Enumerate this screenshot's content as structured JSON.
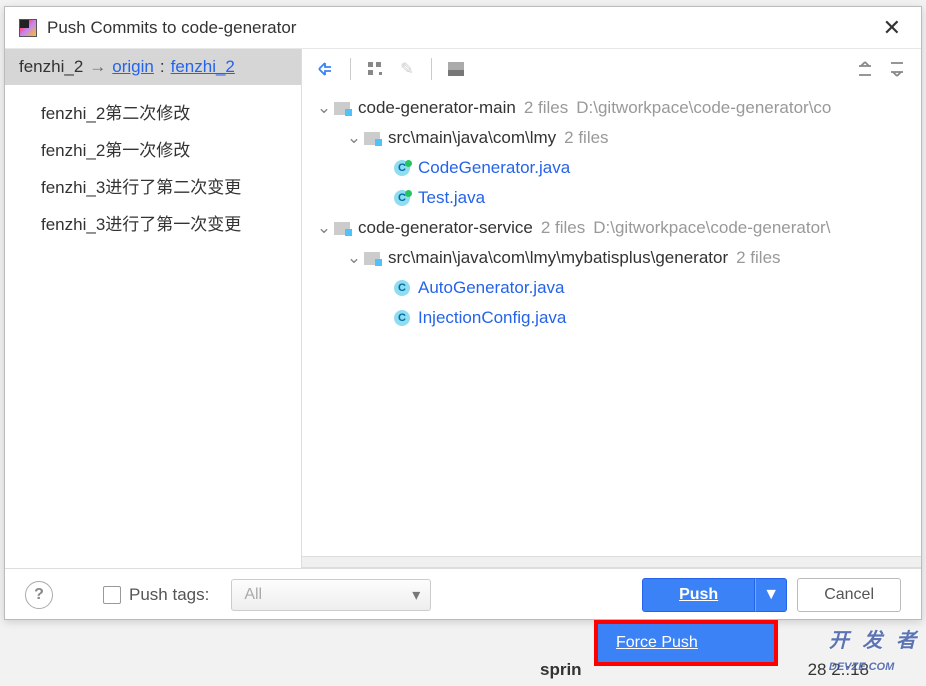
{
  "dialog": {
    "title": "Push Commits to code-generator"
  },
  "branch": {
    "local": "fenzhi_2",
    "remote": "origin",
    "remoteBranch": "fenzhi_2"
  },
  "commits": [
    "fenzhi_2第二次修改",
    "fenzhi_2第一次修改",
    "fenzhi_3进行了第二次变更",
    "fenzhi_3进行了第一次变更"
  ],
  "tree": {
    "module1": {
      "name": "code-generator-main",
      "count": "2 files",
      "path": "D:\\gitworkpace\\code-generator\\co",
      "pkg": {
        "name": "src\\main\\java\\com\\lmy",
        "count": "2 files"
      },
      "files": [
        "CodeGenerator.java",
        "Test.java"
      ]
    },
    "module2": {
      "name": "code-generator-service",
      "count": "2 files",
      "path": "D:\\gitworkpace\\code-generator\\",
      "pkg": {
        "name": "src\\main\\java\\com\\lmy\\mybatisplus\\generator",
        "count": "2 files"
      },
      "files": [
        "AutoGenerator.java",
        "InjectionConfig.java"
      ]
    }
  },
  "footer": {
    "pushTags": "Push tags:",
    "tagsValue": "All",
    "pushBtn": "Push",
    "cancelBtn": "Cancel",
    "forcePush": "Force Push"
  },
  "watermark": {
    "prefix": "sprin",
    "suffix": "28 2.:18",
    "brand": "开 发 者",
    "brand2": "DEVZE.COM"
  }
}
